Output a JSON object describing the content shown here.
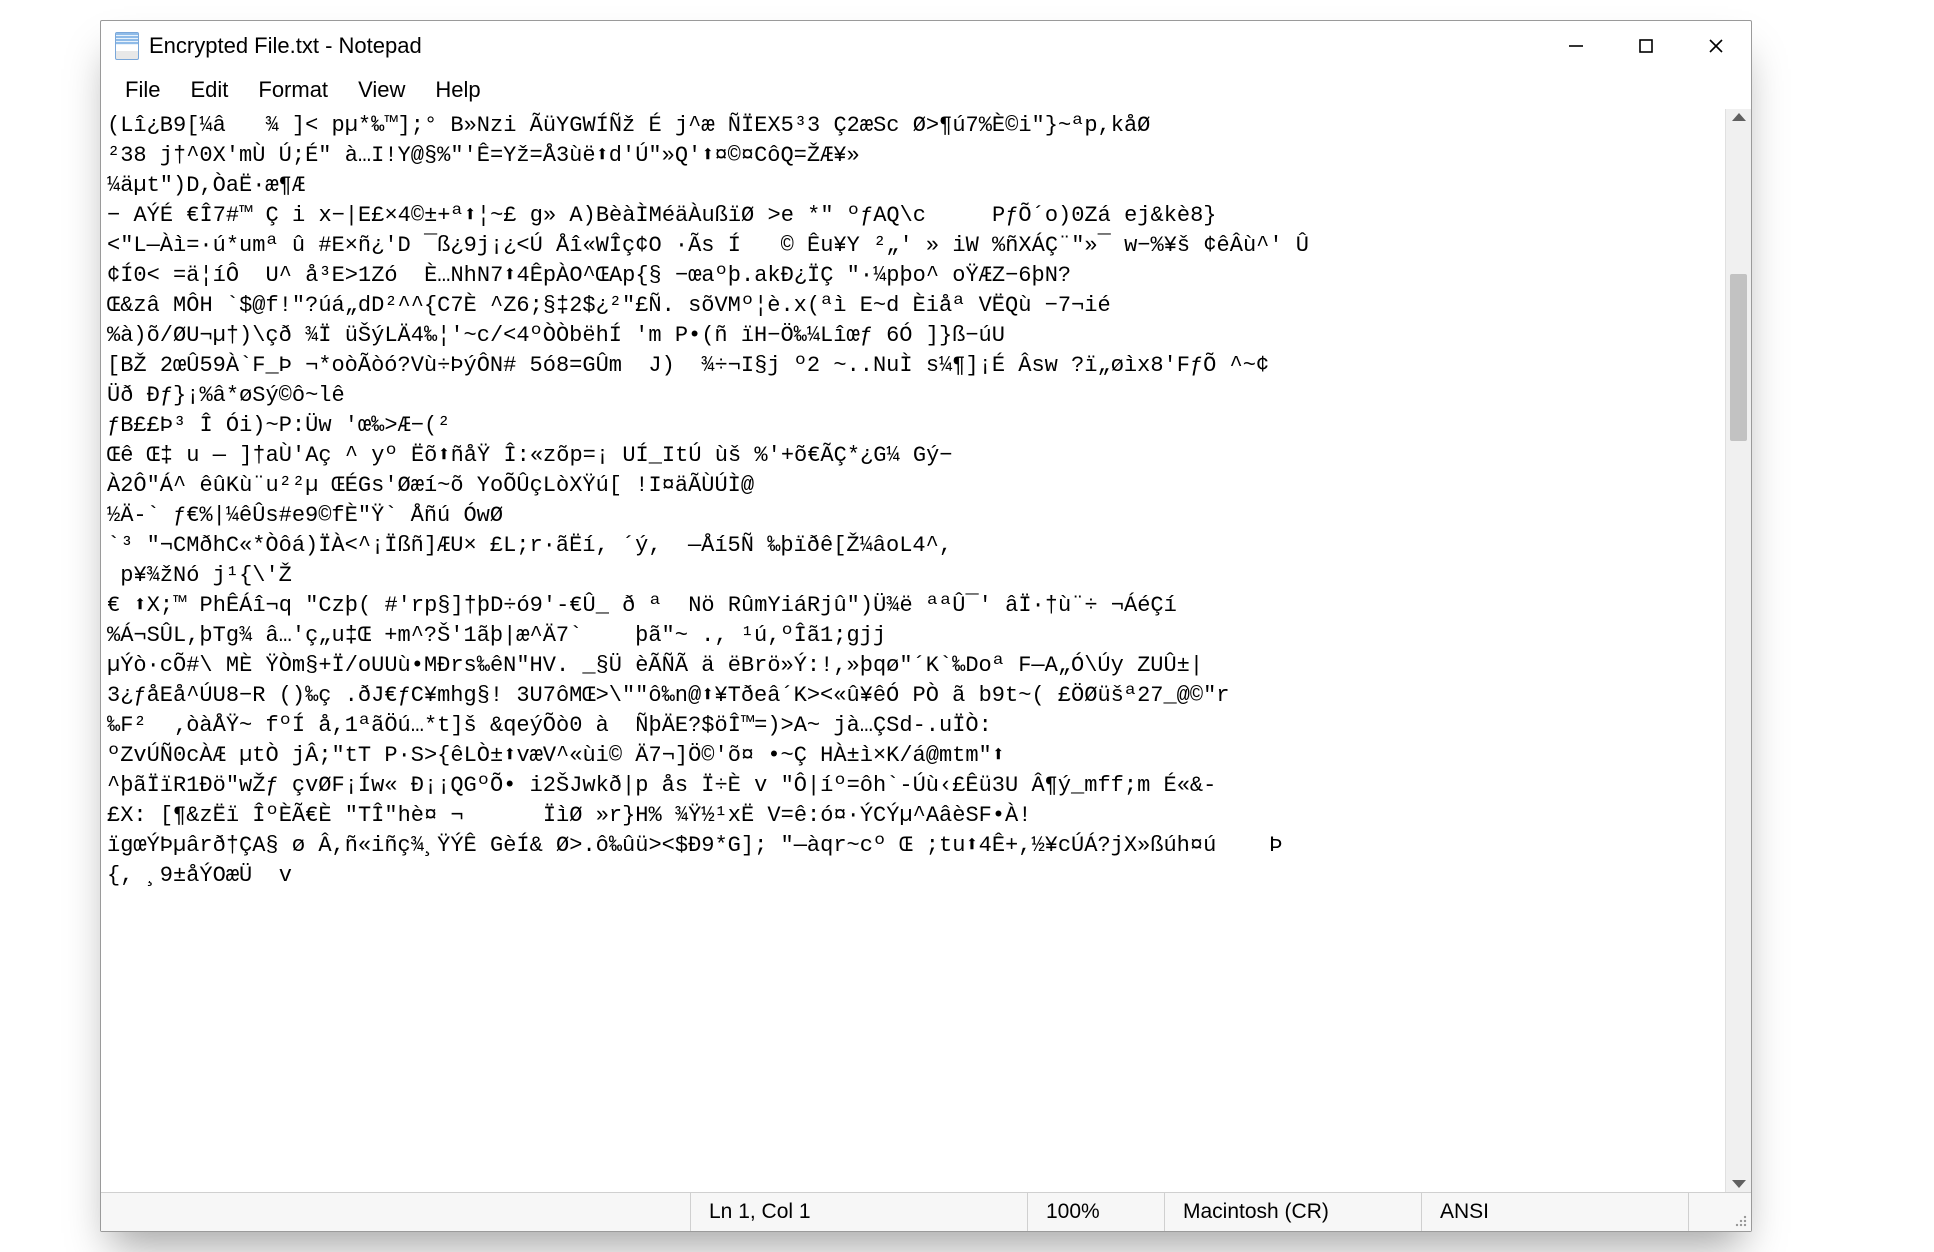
{
  "window": {
    "title": "Encrypted File.txt - Notepad"
  },
  "menu": {
    "file": "File",
    "edit": "Edit",
    "format": "Format",
    "view": "View",
    "help": "Help"
  },
  "content": "(Lî¿B9[¼â￻  ¾￻]< pµ*‰™];°￻B»Nzi￻ÃüYGWÍÑž￻É￻j^æ￻ÑÏEX5³3￻Ç2æSc￻Ø>¶ú7%È©i\"}~ªp,kåØ\n²38 j†^0X'mÙ￻Ú;É\"￻à…I!Y@§%\"'Ê=Yž=Å3ùë⬆d'Ú\"»Q'⬆¤©¤CôQ=ŽÆ¥»\n¼äµt\")D,ÒaË·æ¶Æ\n−￻AÝÉ￻€Î7#™￻Ç￻i￻x−|E£×4©±+ª⬆¦~£￻g»￻A)BèàÌMéäÀußïØ￻>e￻*\"￻ºƒAQ\\c     PƒÕ´o)0Zá￻ej&kè8}\n<\"L—Àì=·ú*umª￻û￻#E×ñ¿'D￻¯ß¿9j¡¿<Ú￻Åî«WÎç¢O￻·Ãs￻Í   ©￻Êu¥Y￻²„'￻»￻iW￻%ñXÁÇ¨\"»¯￻w−%¥š￻¢êÂù^'￻Û\n¢Í0<￻=ä¦íÔ￻￻U^￻å³E>1Zó￻ È…NhN7⬆4ÊpÀO^ŒAp{§￻−œaºþ.akÐ¿ÏÇ￻\"·¼pþo^ oŸÆZ−6þN?\nŒ&zâ￻MÔH￻`$@f!\"?úá„dD²^^{C7È￻^Z6;§‡2$¿²\"£Ñ.￻sõVMº¦è.x(ªì E~d￻Èiåª￻VËQù￻−7¬ié\n%à)õ/ØU¬µ†)\\çð￻¾Ï￻üŠýLÄ4‰¦'~c/<4ºÒÒbëhÍ 'm￻P•(ñ ïH−Ö‰¼Lîœƒ￻6Ó￻]}ß−úU\n[BŽ￻2œÛ59À`F_Þ ¬*oòÃòó?Vù÷ÞýÔN#￻5ó8=GÛm  J)￻￻¾÷¬I§j￻º2￻~..NuÌ￻s¼¶]¡É Âsw￻?ï„øìx8'FƒÕ ^~¢\nÜð￻Ðƒ}¡%â*øSý©ô~lê\nƒB££Þ³￻Î￻Ói)~P:Üw￻'œ‰>Æ−(²\nŒê￻Œ‡￻u￻—￻]†aÙ'Aç￻^￻yº￻Ëõ⬆ñåŸ￻Î:«zõp=¡￻UÍ_ItÚ￻ùš￻%'+õ€ÃÇ*¿G¼￻Gý−\nÀ2Ô\"Á^￻êûKù¨u²²µ￻ŒÉGs'Øæí~õ￻YoÕÛçLòXŸú[￻!I¤äÃÙÚÌ@\n½Ä-` ƒ€%|¼êÛs#e9©fÈ\"Ÿ` Åñú ÓwØ\n`³ \"¬CMðhC«*Òôá)ÏÀ<^¡Ïßñ]ÆU× £L;r·ãËí,￻´ý,  —Åí5Ñ￻‰þïðê[Ž¼âoL4^,\n￻p¥¾žNó j¹{\\'Ž\n€￻⬆X;™￻PhÊÁî¬q￻\"Czþ(￻#'rp§]†þD÷ó9'-€Û_￻ð￻ª  Nö￻RûmYiáRjû\")Ü¾ë ªªÛ¯'￻âÏ·†ù¨÷￻¬ÁéÇí\n%Á¬SÛL,þTg¾￻â…'ç„u‡Œ +m^?Š'1ãþ|æ^Ä7`    þã\"~￻.,￻¹ú,ºÎã1;gjj\nµÝò·cÕ#\\￻MÈ￻ŸÒm§+Ï/oUUù•MÐrs‰êN\"HV. _§Ü￻èÃÑÃ￻ä￻ëBrö»Ý:!,»þqø\"´K`‰Doª￻F—A„Ó\\Úy￻ZUÛ±|\n3¿ƒåEå^ÚU8−R￻()‰ç .ðJ€ƒC¥mhg§!￻3U7ôMŒ>\\\"\"ô‰n@⬆¥Tðeâ´K><«û¥êÓ￻PÒ￻ã￻b9t~(￻£ÖØüšª27_@©\"r\n‰F²  ‚òàÅŸ~￻fºÍ￻å,1ªãÖú…*t]š￻&qeýÕò0￻à ￻ÑþÄE?$öÎ™=)>A~￻jà…ÇSd-.uÏÒ:\nºZvÚÑ0cÀÆ￻µtÒ￻jÂ;\"tT￻P·S>{êLÒ±⬆væV^«ùi©￻Ä7¬]Ö©'õ¤ •~Ç HÀ±ì×K/á@mtm\"⬆\n^þãÏïR1Ðö\"wŽƒ￻çvØF¡Íw«￻Ð¡¡QGºÕ•￻i2ŠJwkð|p￻ås Ï÷È￻v￻\"Ô|íº=ôh`-Úù‹£Êü3U￻Â¶ý_mff;m￻É«&-\n£X:￻[¶&zËï￻ÎºÈÃ€È￻\"TÎ\"hè¤￻¬      ÏìØ￻»r}H%￻¾Ÿ½¹xË￻V=ê:ó¤·ÝCÝµ^AâèSF•À!\nïgœÝÞµârð†ÇA§￻ø￻Â,ñ«iñç¾¸ŸÝÊ￻GèÍ&￻Ø>.ô‰ûü><$Ð9*G];￻\"—àqr~cº￻Œ ;tu⬆4Ê+,½¥cÚÁ?jX»ßúh¤ú￻￻￻ Þ\n{, ¸9±åÝOæÜ￻￻v",
  "statusbar": {
    "position": "Ln 1, Col 1",
    "zoom": "100%",
    "lineending": "Macintosh (CR)",
    "encoding": "ANSI"
  }
}
